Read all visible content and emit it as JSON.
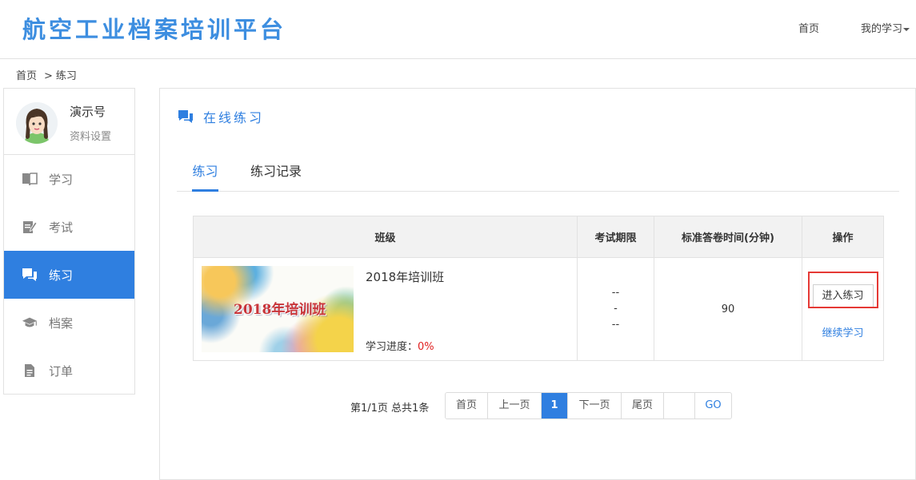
{
  "header": {
    "logo": "航空工业档案培训平台",
    "nav_home": "首页",
    "nav_my": "我的学习"
  },
  "breadcrumb": {
    "home": "首页",
    "sep": ">",
    "current": "练习"
  },
  "sidebar": {
    "user_name": "演示号",
    "settings_link": "资料设置",
    "items": [
      {
        "label": "学习",
        "icon": "book-icon"
      },
      {
        "label": "考试",
        "icon": "edit-icon"
      },
      {
        "label": "练习",
        "icon": "chat-icon",
        "active": true
      },
      {
        "label": "档案",
        "icon": "graduation-cap-icon"
      },
      {
        "label": "订单",
        "icon": "document-icon"
      }
    ]
  },
  "main": {
    "title": "在线练习",
    "tabs": [
      "练习",
      "练习记录"
    ],
    "table": {
      "headers": [
        "班级",
        "考试期限",
        "标准答卷时间(分钟)",
        "操作"
      ],
      "rows": [
        {
          "thumb_text": "2018年培训班",
          "class_name": "2018年培训班",
          "progress_label": "学习进度：",
          "progress_value": "0%",
          "period_start": "--",
          "period_sep": "-",
          "period_end": "--",
          "time": "90",
          "action_primary": "进入练习",
          "action_secondary": "继续学习"
        }
      ]
    },
    "pagination": {
      "info": "第1/1页 总共1条",
      "first": "首页",
      "prev": "上一页",
      "current": "1",
      "next": "下一页",
      "last": "尾页",
      "go": "GO"
    }
  },
  "colors": {
    "accent": "#2f7fe0",
    "highlight": "#e53935",
    "progress": "#e02020"
  }
}
